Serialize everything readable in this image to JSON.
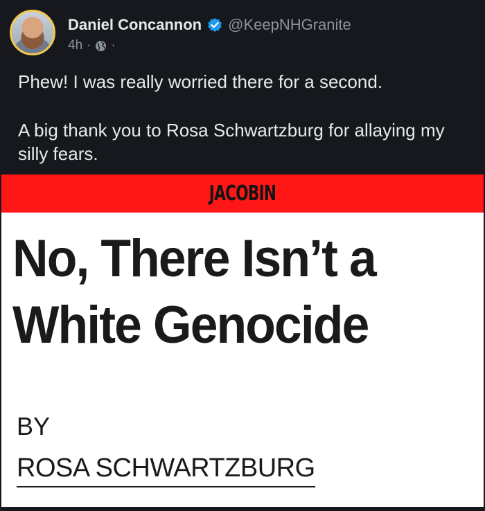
{
  "post": {
    "author": {
      "display_name": "Daniel Concannon",
      "handle": "@KeepNHGranite",
      "verified": true,
      "avatar_border_color": "#f2c94c",
      "verified_color": "#1d9bf0"
    },
    "meta": {
      "time": "4h",
      "separator": "·",
      "visibility_icon": "globe-icon"
    },
    "text": {
      "paragraph_1": "Phew! I was really worried there for a second.",
      "paragraph_2": "A big thank you to Rosa Schwartzburg for allaying my silly fears."
    }
  },
  "article": {
    "masthead": "JACOBIN",
    "masthead_color": "#ff1717",
    "headline_line_1": "No, There Isn’t a",
    "headline_line_2": "White Genocide",
    "byline_label": "BY",
    "author": "ROSA SCHWARTZBURG"
  }
}
